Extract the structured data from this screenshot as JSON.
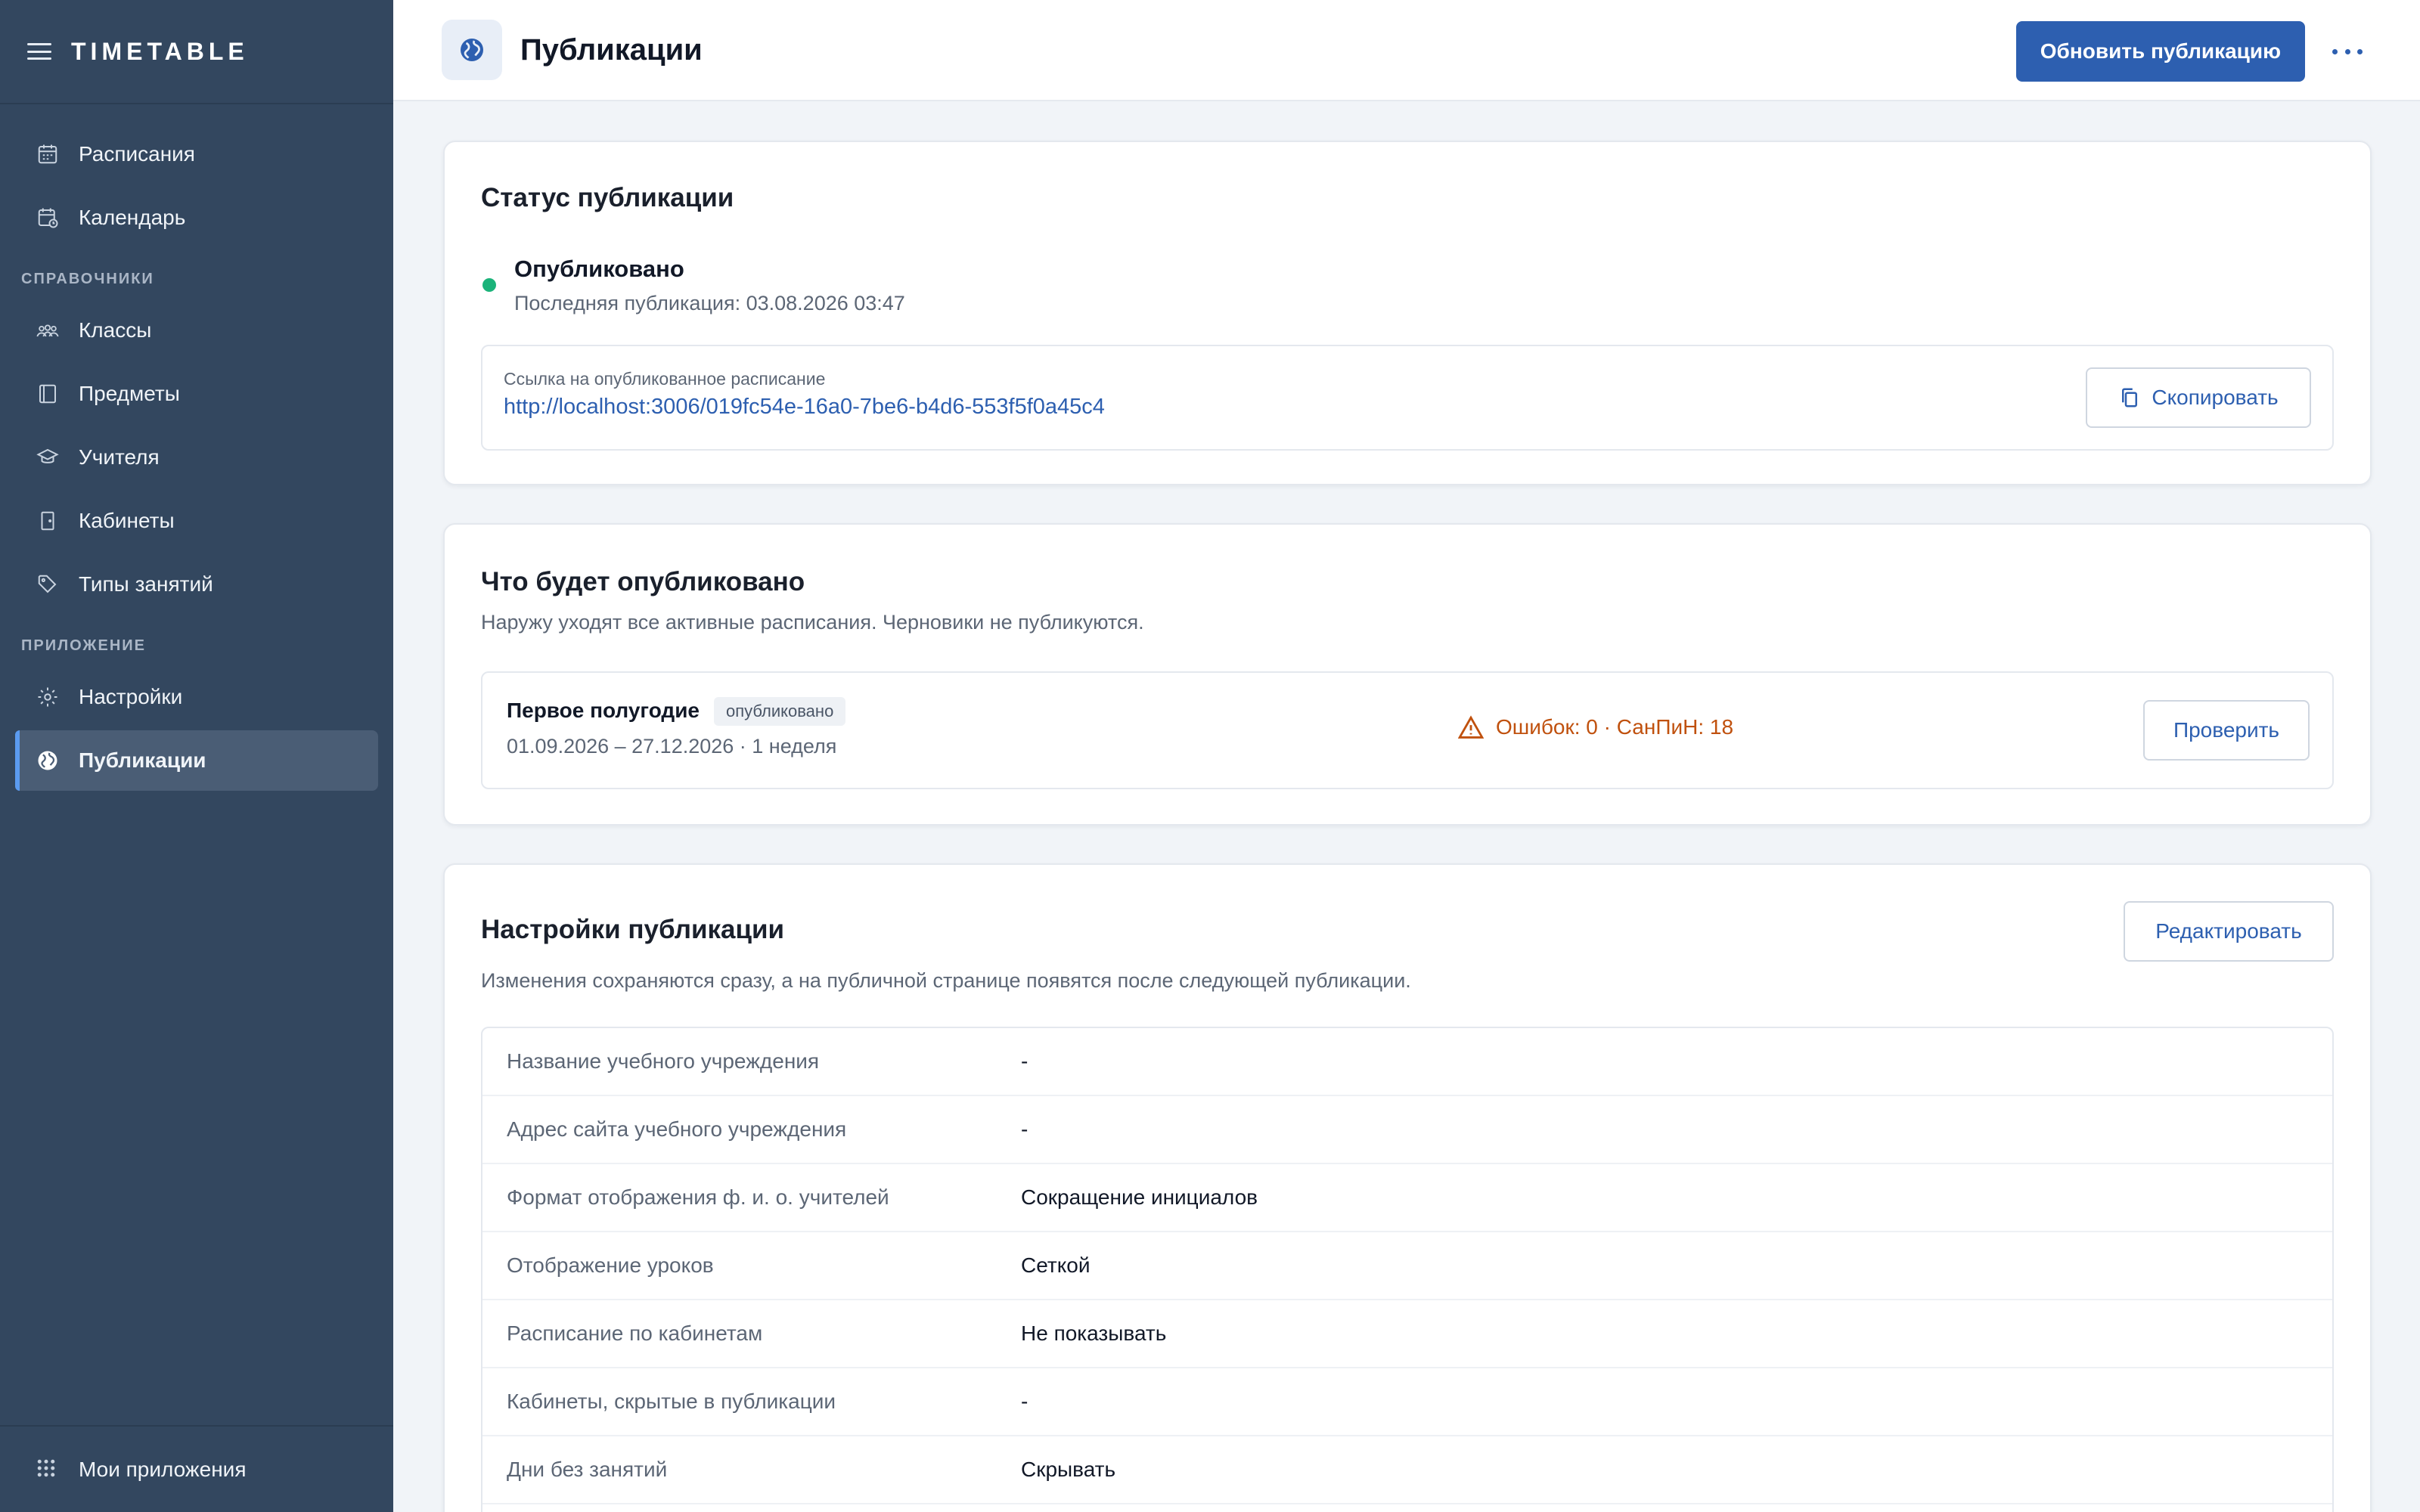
{
  "app": {
    "brand": "TIMETABLE"
  },
  "sidebar": {
    "top_items": [
      {
        "label": "Расписания",
        "icon": "calendar-grid-icon"
      },
      {
        "label": "Календарь",
        "icon": "calendar-clock-icon"
      }
    ],
    "section_refs": "СПРАВОЧНИКИ",
    "ref_items": [
      {
        "label": "Классы",
        "icon": "people-icon"
      },
      {
        "label": "Предметы",
        "icon": "book-icon"
      },
      {
        "label": "Учителя",
        "icon": "graduation-cap-icon"
      },
      {
        "label": "Кабинеты",
        "icon": "door-icon"
      },
      {
        "label": "Типы занятий",
        "icon": "tag-icon"
      }
    ],
    "section_app": "ПРИЛОЖЕНИЕ",
    "app_items": [
      {
        "label": "Настройки",
        "icon": "gear-icon"
      },
      {
        "label": "Публикации",
        "icon": "globe-icon",
        "active": true
      }
    ],
    "footer_label": "Мои приложения"
  },
  "header": {
    "title": "Публикации",
    "primary_button": "Обновить публикацию"
  },
  "status_card": {
    "title": "Статус публикации",
    "status": "Опубликовано",
    "last_published": "Последняя публикация: 03.08.2026 03:47",
    "link_caption": "Ссылка на опубликованное расписание",
    "link_url": "http://localhost:3006/019fc54e-16a0-7be6-b4d6-553f5f0a45c4",
    "copy_button": "Скопировать"
  },
  "preview_card": {
    "title": "Что будет опубликовано",
    "subtitle": "Наружу уходят все активные расписания. Черновики не публикуются.",
    "schedule": {
      "name": "Первое полугодие",
      "badge": "опубликовано",
      "dates": "01.09.2026 – 27.12.2026 · 1 неделя",
      "warnings": "Ошибок: 0 · СанПиН: 18",
      "check_button": "Проверить"
    }
  },
  "settings_card": {
    "title": "Настройки публикации",
    "subtitle": "Изменения сохраняются сразу, а на публичной странице появятся после следующей публикации.",
    "edit_button": "Редактировать",
    "rows": [
      {
        "key": "Название учебного учреждения",
        "value": "-"
      },
      {
        "key": "Адрес сайта учебного учреждения",
        "value": "-"
      },
      {
        "key": "Формат отображения ф. и. о. учителей",
        "value": "Сокращение инициалов"
      },
      {
        "key": "Отображение уроков",
        "value": "Сеткой"
      },
      {
        "key": "Расписание по кабинетам",
        "value": "Не показывать"
      },
      {
        "key": "Кабинеты, скрытые в публикации",
        "value": "-"
      },
      {
        "key": "Дни без занятий",
        "value": "Скрывать"
      }
    ]
  },
  "colors": {
    "sidebar_bg": "#33475f",
    "accent": "#2d5fb0",
    "status_ok": "#1bb37a",
    "warning": "#c0510e"
  }
}
